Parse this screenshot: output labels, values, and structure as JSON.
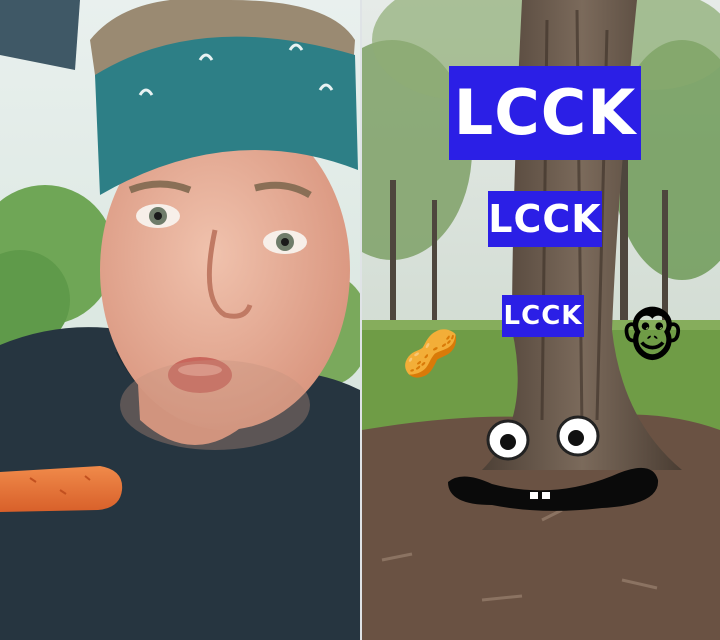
{
  "scene": {
    "layout": "side-by-side-duet",
    "left_panel": "person-with-carrot",
    "right_panel": "tree-with-face"
  },
  "captions": [
    {
      "text": "LCCK"
    },
    {
      "text": "LCCK"
    },
    {
      "text": "LCCK"
    }
  ],
  "stickers": {
    "peanut": "🥜",
    "monkey": "🐵"
  },
  "colors": {
    "caption_bg": "#2b1fe6",
    "caption_text": "#ffffff",
    "bandana": "#2d7f86",
    "shirt": "#263540",
    "carrot": "#e8743a",
    "grass": "#6f9c46"
  }
}
